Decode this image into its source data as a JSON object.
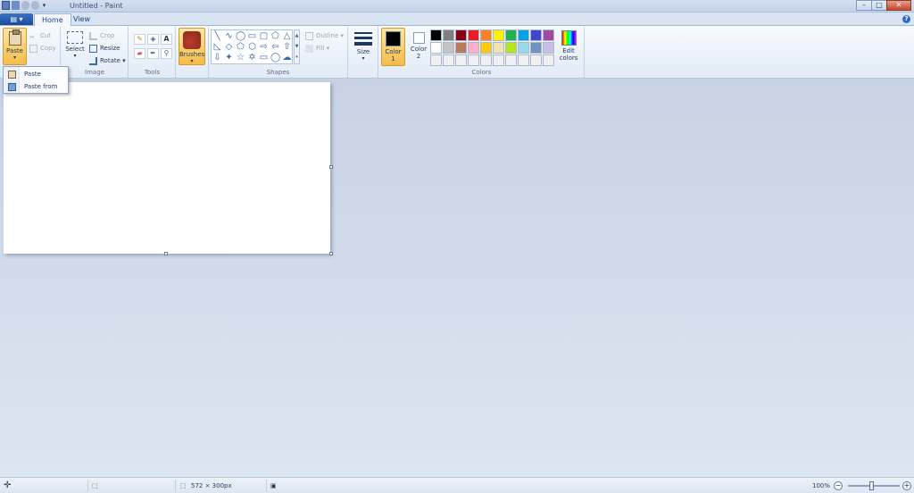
{
  "window": {
    "title": "Untitled - Paint",
    "buttons": {
      "minimize": "–",
      "maximize": "□",
      "close": "✕"
    }
  },
  "tabs": {
    "file_label": "▤ ▾",
    "items": [
      {
        "label": "Home",
        "active": true
      },
      {
        "label": "View",
        "active": false
      }
    ],
    "help": "?"
  },
  "ribbon": {
    "clipboard": {
      "paste": "Paste",
      "cut": "Cut",
      "copy": "Copy"
    },
    "image": {
      "select": "Select",
      "crop": "Crop",
      "resize": "Resize",
      "rotate": "Rotate",
      "group_label": "Image"
    },
    "tools": {
      "group_label": "Tools",
      "text_tool": "A"
    },
    "brushes": {
      "label": "Brushes"
    },
    "shapes": {
      "outline": "Outline",
      "fill": "Fill",
      "group_label": "Shapes"
    },
    "size": {
      "label": "Size"
    },
    "colors": {
      "color1_line1": "Color",
      "color1_line2": "1",
      "color2_line1": "Color",
      "color2_line2": "2",
      "edit_line1": "Edit",
      "edit_line2": "colors",
      "group_label": "Colors",
      "color1_value": "#000000",
      "color2_value": "#ffffff",
      "palette": [
        "#000000",
        "#7f7f7f",
        "#880015",
        "#ed1c24",
        "#ff7f27",
        "#fff200",
        "#22b14c",
        "#00a2e8",
        "#3f48cc",
        "#a349a4",
        "#ffffff",
        "#c3c3c3",
        "#b97a57",
        "#ffaec9",
        "#ffc90e",
        "#efe4b0",
        "#b5e61d",
        "#99d9ea",
        "#7092be",
        "#c8bfe7",
        "#f0f0f0",
        "#f0f0f0",
        "#f0f0f0",
        "#f0f0f0",
        "#f0f0f0",
        "#f0f0f0",
        "#f0f0f0",
        "#f0f0f0",
        "#f0f0f0",
        "#f0f0f0"
      ]
    }
  },
  "paste_menu": {
    "paste": "Paste",
    "paste_from": "Paste from"
  },
  "statusbar": {
    "canvas_size": "572 × 300px",
    "zoom": "100%",
    "zoom_out": "−",
    "zoom_in": "+"
  }
}
